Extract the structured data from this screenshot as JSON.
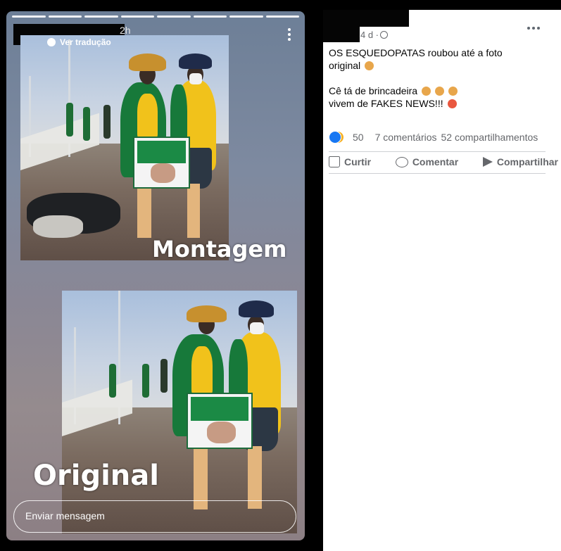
{
  "story": {
    "time": "2h",
    "translate_label": "Ver tradução",
    "caption_top": "Montagem",
    "caption_bottom": "Original",
    "reply_placeholder": "Enviar mensagem"
  },
  "post": {
    "time": "4 d ·",
    "lines": [
      "OS ESQUEDOPATAS roubou até a foto",
      "original",
      "Cê tá de brincadeira",
      "vivem de FAKES NEWS!!!"
    ],
    "reaction_count": "50",
    "comments": "7 comentários",
    "shares": "52 compartilhamentos",
    "actions": {
      "like": "Curtir",
      "comment": "Comentar",
      "share": "Compartilhar"
    }
  }
}
